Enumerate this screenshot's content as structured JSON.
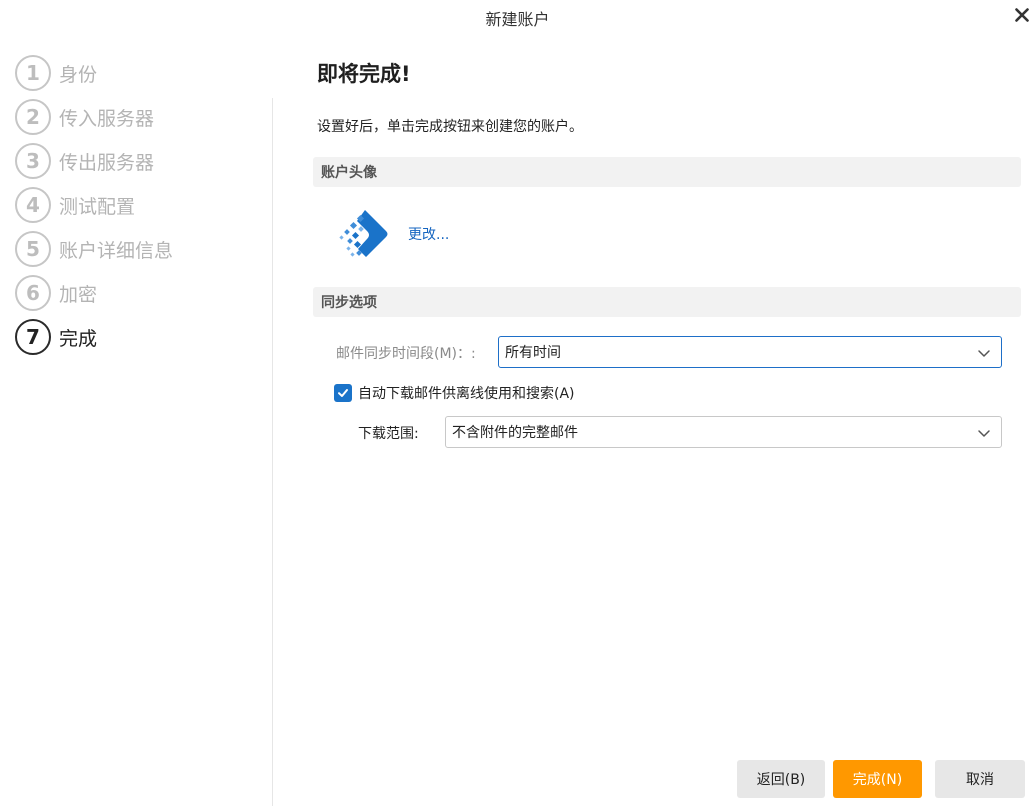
{
  "window": {
    "title": "新建账户",
    "close_icon": "close-icon"
  },
  "steps": [
    {
      "number": "1",
      "label": "身份",
      "active": false
    },
    {
      "number": "2",
      "label": "传入服务器",
      "active": false
    },
    {
      "number": "3",
      "label": "传出服务器",
      "active": false
    },
    {
      "number": "4",
      "label": "测试配置",
      "active": false
    },
    {
      "number": "5",
      "label": "账户详细信息",
      "active": false
    },
    {
      "number": "6",
      "label": "加密",
      "active": false
    },
    {
      "number": "7",
      "label": "完成",
      "active": true
    }
  ],
  "main": {
    "heading": "即将完成!",
    "description": "设置好后，单击完成按钮来创建您的账户。",
    "avatar_section": {
      "title": "账户头像",
      "icon": "account-avatar-icon",
      "change_link": "更改..."
    },
    "sync_section": {
      "title": "同步选项",
      "sync_period_label": "邮件同步时间段(M)：:",
      "sync_period_value": "所有时间",
      "offline_checkbox_label": "自动下载邮件供离线使用和搜索(A)",
      "offline_checkbox_checked": true,
      "download_scope_label": "下载范围:",
      "download_scope_value": "不含附件的完整邮件"
    }
  },
  "footer": {
    "back_label": "返回(B)",
    "finish_label": "完成(N)",
    "cancel_label": "取消"
  },
  "colors": {
    "accent": "#ff9800",
    "link": "#1565c0",
    "checkbox": "#1a73c9",
    "focus_border": "#1e6fc8"
  }
}
